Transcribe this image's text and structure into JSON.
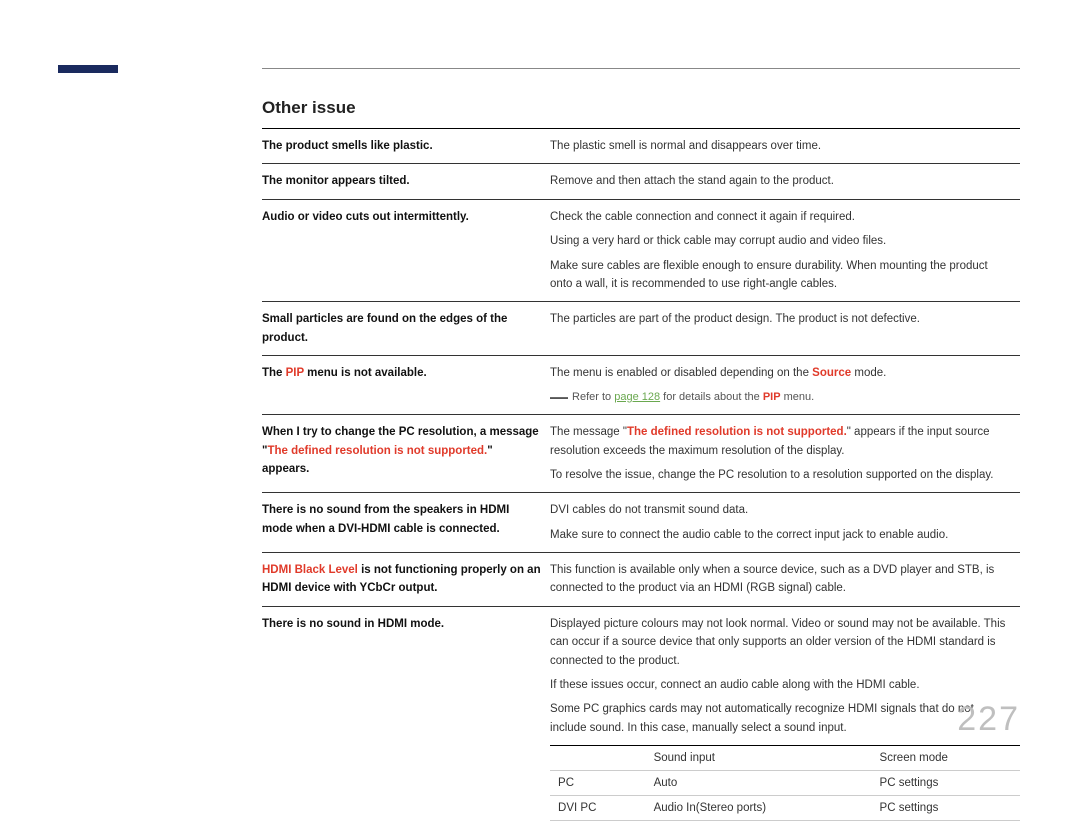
{
  "page_number": "227",
  "heading": "Other issue",
  "rows": [
    {
      "issue": {
        "plain": "The product smells like plastic."
      },
      "sol": [
        {
          "plain": "The plastic smell is normal and disappears over time."
        }
      ]
    },
    {
      "issue": {
        "plain": "The monitor appears tilted."
      },
      "sol": [
        {
          "plain": "Remove and then attach the stand again to the product."
        }
      ]
    },
    {
      "issue": {
        "plain": "Audio or video cuts out intermittently."
      },
      "sol": [
        {
          "plain": "Check the cable connection and connect it again if required."
        },
        {
          "plain": "Using a very hard or thick cable may corrupt audio and video files."
        },
        {
          "plain": "Make sure cables are flexible enough to ensure durability. When mounting the product onto a wall, it is recommended to use right-angle cables."
        }
      ]
    },
    {
      "issue": {
        "plain": "Small particles are found on the edges of the product."
      },
      "sol": [
        {
          "plain": "The particles are part of the product design. The product is not defective."
        }
      ]
    },
    {
      "issue": {
        "pre": "The ",
        "red": "PIP",
        "post": " menu is not available."
      },
      "sol": [
        {
          "pre": "The menu is enabled or disabled depending on the ",
          "red": "Source",
          "post": " mode."
        }
      ],
      "note": {
        "pre": "Refer to ",
        "link": "page 128",
        "mid": " for details about the ",
        "red": "PIP",
        "post": " menu."
      }
    },
    {
      "issue": {
        "pre": "When I try to change the PC resolution, a message \"",
        "red": "The defined resolution is not supported.",
        "post": "\" appears."
      },
      "sol": [
        {
          "pre": "The message \"",
          "red": "The defined resolution is not supported.",
          "post": "\" appears if the input source resolution exceeds the maximum resolution of the display."
        },
        {
          "plain": "To resolve the issue, change the PC resolution to a resolution supported on the display."
        }
      ]
    },
    {
      "issue": {
        "plain": "There is no sound from the speakers in HDMI mode when a DVI-HDMI cable is connected."
      },
      "sol": [
        {
          "plain": "DVI cables do not transmit sound data."
        },
        {
          "plain": "Make sure to connect the audio cable to the correct input jack to enable audio."
        }
      ]
    },
    {
      "issue": {
        "red": "HDMI Black Level",
        "post": " is not functioning properly on an HDMI device with YCbCr output."
      },
      "sol": [
        {
          "plain": "This function is available only when a source device, such as a DVD player and STB, is connected to the product via an HDMI (RGB signal) cable."
        }
      ]
    },
    {
      "issue": {
        "plain": "There is no sound in HDMI mode."
      },
      "sol": [
        {
          "plain": "Displayed picture colours may not look normal. Video or sound may not be available. This can occur if a source device that only supports an older version of the HDMI standard is connected to the product."
        },
        {
          "plain": "If these issues occur, connect an audio cable along with the HDMI cable."
        },
        {
          "plain": "Some PC graphics cards may not automatically recognize HDMI signals that do not include sound. In this case, manually select a sound input."
        }
      ]
    }
  ],
  "mini_table": {
    "header": [
      "",
      "Sound input",
      "Screen mode"
    ],
    "rows": [
      [
        "PC",
        "Auto",
        "PC settings"
      ],
      [
        "DVI PC",
        "Audio In(Stereo ports)",
        "PC settings"
      ]
    ]
  }
}
